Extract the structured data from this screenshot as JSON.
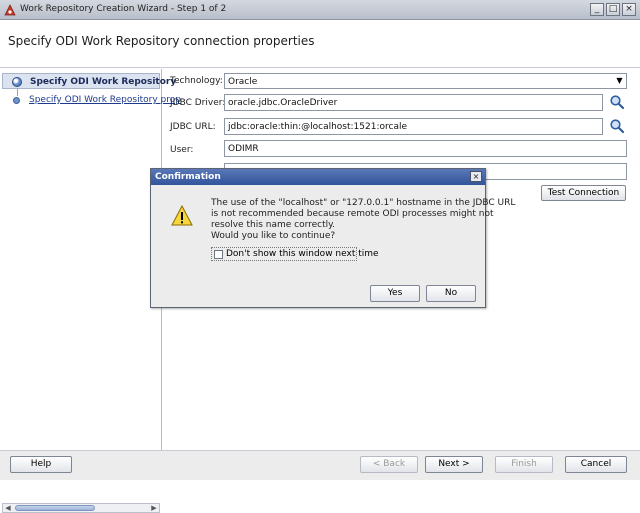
{
  "window": {
    "title": "Work Repository Creation Wizard - Step 1 of 2",
    "controls": [
      "minimize",
      "maximize",
      "close"
    ]
  },
  "header": {
    "title": "Specify ODI Work Repository connection properties"
  },
  "nav": {
    "steps": [
      {
        "label": "Specify ODI Work Repository",
        "active": true
      },
      {
        "label": "Specify ODI Work Repository prop",
        "active": false
      }
    ]
  },
  "form": {
    "technology_label": "Technology:",
    "technology_value": "Oracle",
    "jdbc_driver_label": "JDBC Driver:",
    "jdbc_driver_value": "oracle.jdbc.OracleDriver",
    "jdbc_url_label": "JDBC URL:",
    "jdbc_url_value": "jdbc:oracle:thin:@localhost:1521:orcale",
    "user_label": "User:",
    "user_value": "ODIMR",
    "test_connection_label": "Test Connection"
  },
  "dialog": {
    "title": "Confirmation",
    "message_lines": [
      "The use of the \"localhost\" or \"127.0.0.1\" hostname in the JDBC URL",
      "is not recommended because remote ODI processes might not",
      "resolve this name correctly.",
      "Would you like to continue?"
    ],
    "checkbox_label": "Don't show this window next time",
    "checkbox_checked": false,
    "yes_label": "Yes",
    "no_label": "No"
  },
  "footer": {
    "help_label": "Help",
    "back_label": "< Back",
    "next_label": "Next >",
    "finish_label": "Finish",
    "cancel_label": "Cancel"
  },
  "colors": {
    "titlebar_dialog": "#31549c",
    "nav_active_bg": "#dbe3f0",
    "link": "#1d3b8c"
  }
}
